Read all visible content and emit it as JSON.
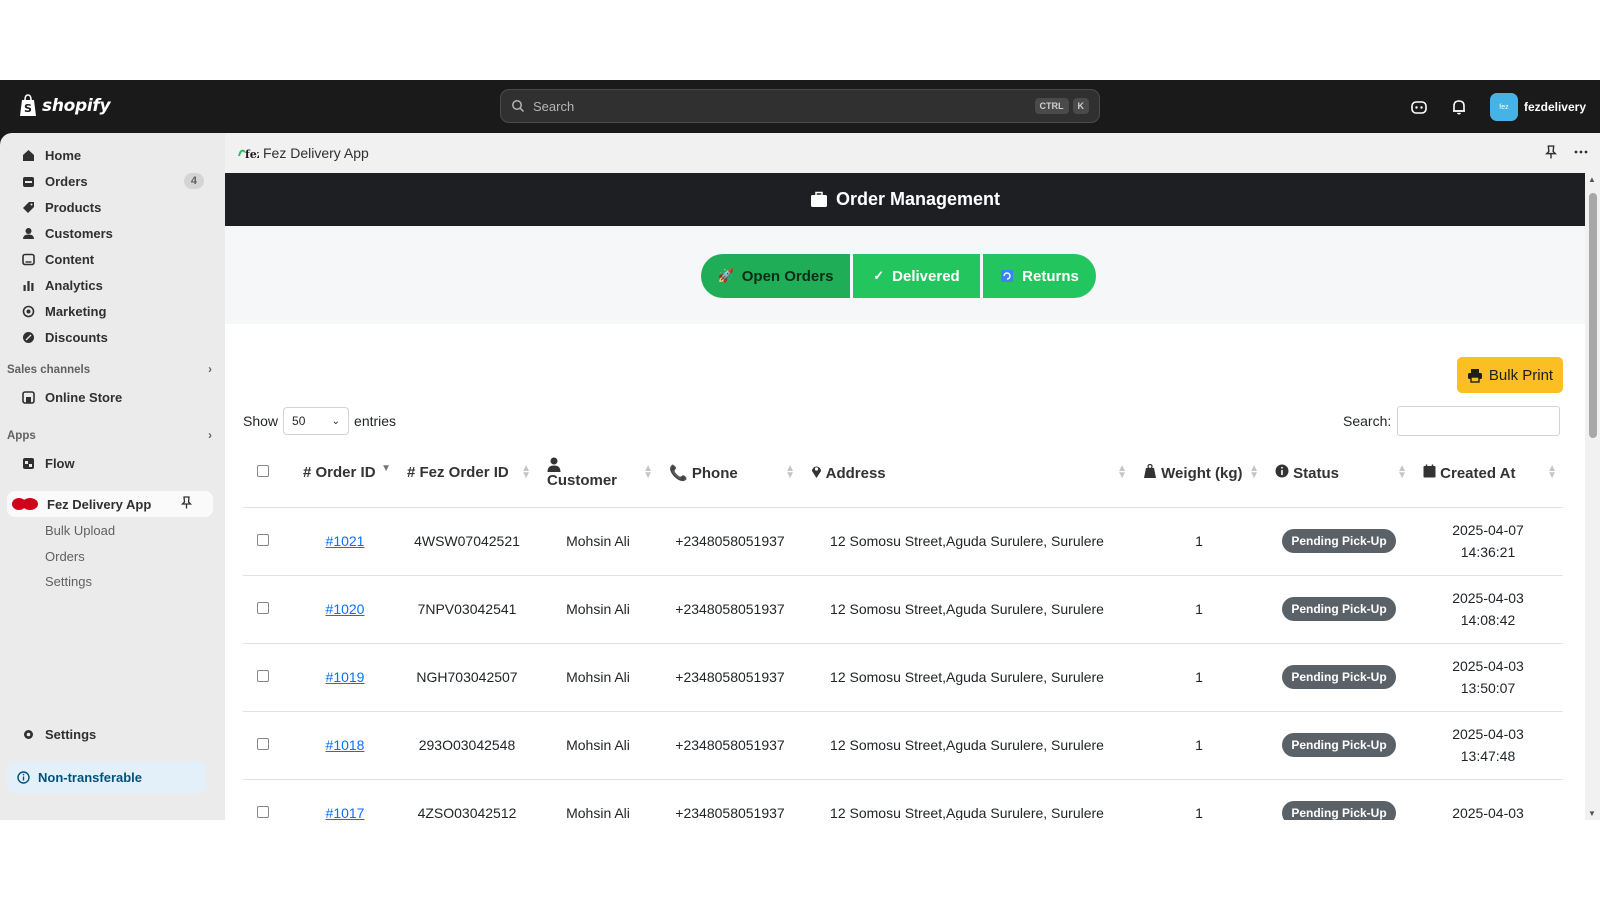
{
  "topbar": {
    "brand": "shopify",
    "search_placeholder": "Search",
    "kbd1": "CTRL",
    "kbd2": "K",
    "avatar_text": "fez",
    "store_name": "fezdelivery"
  },
  "sidebar": {
    "items": [
      {
        "label": "Home",
        "icon": "home-icon"
      },
      {
        "label": "Orders",
        "icon": "orders-icon",
        "badge": "4"
      },
      {
        "label": "Products",
        "icon": "tag-icon"
      },
      {
        "label": "Customers",
        "icon": "person-icon"
      },
      {
        "label": "Content",
        "icon": "content-icon"
      },
      {
        "label": "Analytics",
        "icon": "bar-chart-icon"
      },
      {
        "label": "Marketing",
        "icon": "target-icon"
      },
      {
        "label": "Discounts",
        "icon": "discount-icon"
      }
    ],
    "sales_channels": "Sales channels",
    "online_store": "Online Store",
    "apps": "Apps",
    "flow": "Flow",
    "fez_app": "Fez Delivery App",
    "sub_items": [
      "Bulk Upload",
      "Orders",
      "Settings"
    ],
    "settings": "Settings",
    "non_transferable": "Non-transferable"
  },
  "app": {
    "title": "Fez Delivery App",
    "header": "Order Management",
    "tabs": [
      "Open Orders",
      "Delivered",
      "Returns"
    ],
    "bulk_print": "Bulk Print",
    "show_label": "Show",
    "entries_value": "50",
    "entries_label": "entries",
    "search_label": "Search:"
  },
  "table": {
    "headers": [
      "# Order ID",
      "# Fez Order ID",
      "Customer",
      "Phone",
      "Address",
      "Weight (kg)",
      "Status",
      "Created At"
    ],
    "rows": [
      {
        "order": "#1021",
        "fez": "4WSW07042521",
        "customer": "Mohsin Ali",
        "phone": "+2348058051937",
        "address": "12 Somosu Street,Aguda Surulere, Surulere",
        "weight": "1",
        "status": "Pending Pick-Up",
        "date": "2025-04-07",
        "time": "14:36:21"
      },
      {
        "order": "#1020",
        "fez": "7NPV03042541",
        "customer": "Mohsin Ali",
        "phone": "+2348058051937",
        "address": "12 Somosu Street,Aguda Surulere, Surulere",
        "weight": "1",
        "status": "Pending Pick-Up",
        "date": "2025-04-03",
        "time": "14:08:42"
      },
      {
        "order": "#1019",
        "fez": "NGH703042507",
        "customer": "Mohsin Ali",
        "phone": "+2348058051937",
        "address": "12 Somosu Street,Aguda Surulere, Surulere",
        "weight": "1",
        "status": "Pending Pick-Up",
        "date": "2025-04-03",
        "time": "13:50:07"
      },
      {
        "order": "#1018",
        "fez": "293O03042548",
        "customer": "Mohsin Ali",
        "phone": "+2348058051937",
        "address": "12 Somosu Street,Aguda Surulere, Surulere",
        "weight": "1",
        "status": "Pending Pick-Up",
        "date": "2025-04-03",
        "time": "13:47:48"
      },
      {
        "order": "#1017",
        "fez": "4ZSO03042512",
        "customer": "Mohsin Ali",
        "phone": "+2348058051937",
        "address": "12 Somosu Street,Aguda Surulere, Surulere",
        "weight": "1",
        "status": "Pending Pick-Up",
        "date": "2025-04-03",
        "time": ""
      }
    ]
  },
  "colors": {
    "accent_green": "#22c55e",
    "bulk_yellow": "#fbbf24",
    "status_gray": "#5a6268",
    "link_blue": "#0d6efd"
  }
}
